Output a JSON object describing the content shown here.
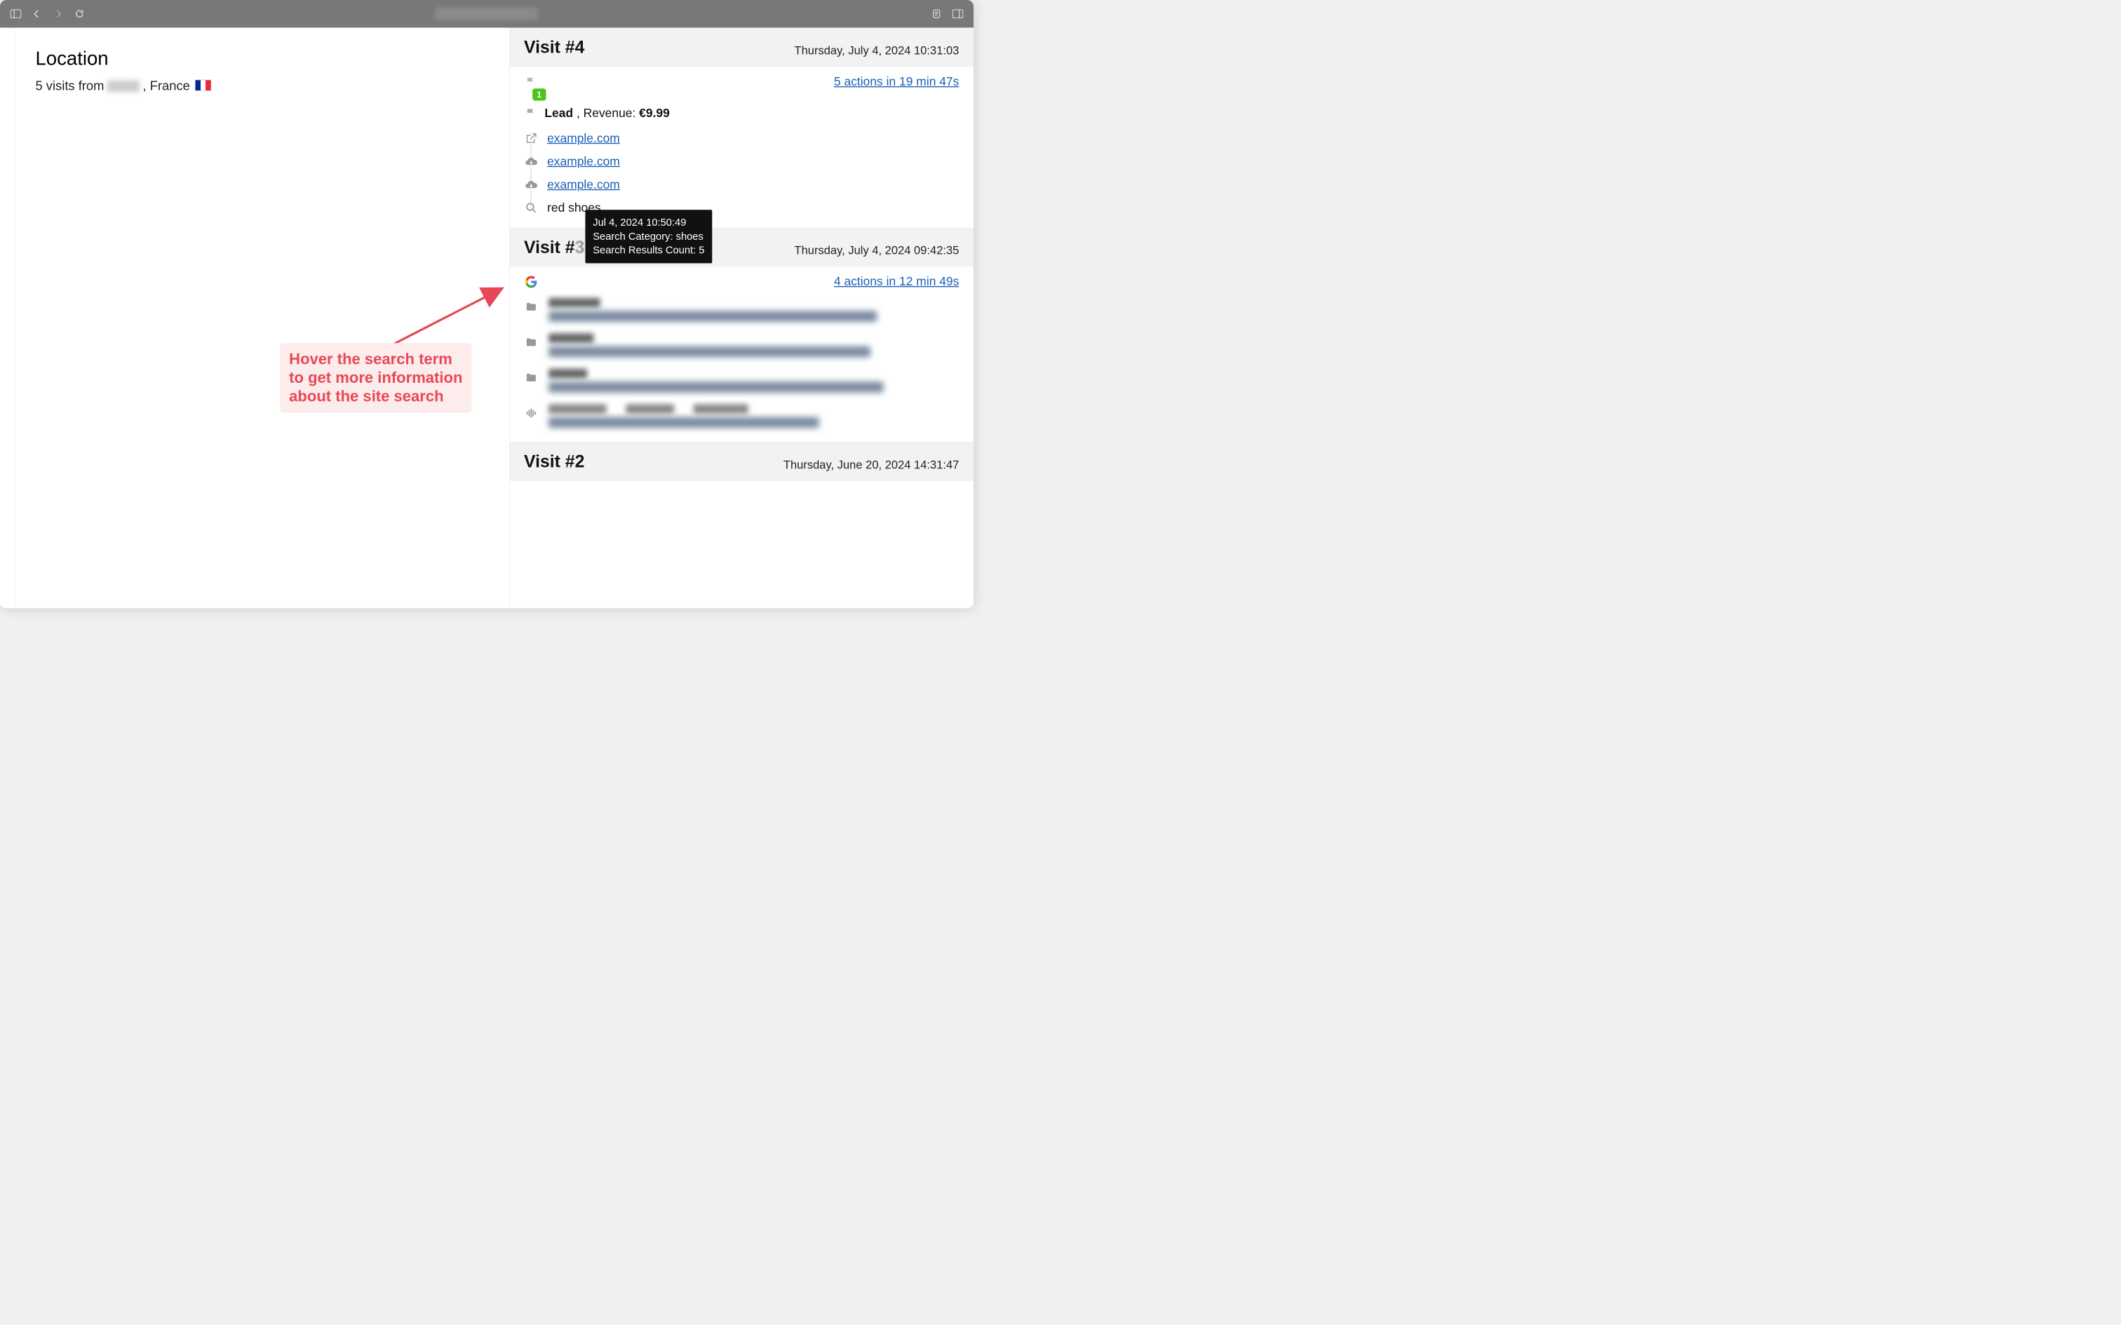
{
  "location": {
    "title": "Location",
    "visits_prefix": "5 visits from ",
    "country_suffix": ", France"
  },
  "visits": [
    {
      "title": "Visit #4",
      "date": "Thursday, July 4, 2024 10:31:03",
      "actions_summary": "5 actions in 19 min 47s",
      "badge": "1",
      "lead_label": "Lead",
      "revenue_label": " , Revenue: ",
      "revenue_value": "€9.99",
      "actions": [
        {
          "type": "outlink",
          "text": "example.com"
        },
        {
          "type": "download",
          "text": "example.com"
        },
        {
          "type": "download",
          "text": "example.com"
        },
        {
          "type": "search",
          "text": "red shoes"
        }
      ]
    },
    {
      "title": "Visit #3",
      "date": "Thursday, July 4, 2024 09:42:35",
      "actions_summary": "4 actions in 12 min 49s",
      "referrer": "google"
    },
    {
      "title": "Visit #2",
      "date": "Thursday, June 20, 2024 14:31:47"
    }
  ],
  "tooltip": {
    "line1": "Jul 4, 2024 10:50:49",
    "line2": "Search Category: shoes",
    "line3": "Search Results Count: 5"
  },
  "annotation": {
    "line1": "Hover the search term",
    "line2": "to get more information",
    "line3": "about the site search"
  }
}
